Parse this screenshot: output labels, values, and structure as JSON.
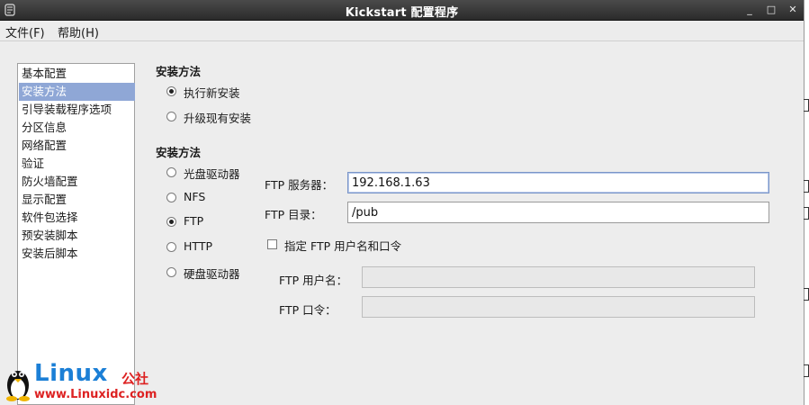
{
  "window": {
    "title": "Kickstart 配置程序",
    "controls": {
      "minimize": "_",
      "maximize": "□",
      "close": "✕"
    }
  },
  "menubar": {
    "file": "文件(F)",
    "help": "帮助(H)"
  },
  "sidebar": {
    "items": [
      {
        "label": "基本配置",
        "selected": false
      },
      {
        "label": "安装方法",
        "selected": true
      },
      {
        "label": "引导装载程序选项",
        "selected": false
      },
      {
        "label": "分区信息",
        "selected": false
      },
      {
        "label": "网络配置",
        "selected": false
      },
      {
        "label": "验证",
        "selected": false
      },
      {
        "label": "防火墙配置",
        "selected": false
      },
      {
        "label": "显示配置",
        "selected": false
      },
      {
        "label": "软件包选择",
        "selected": false
      },
      {
        "label": "预安装脚本",
        "selected": false
      },
      {
        "label": "安装后脚本",
        "selected": false
      }
    ]
  },
  "install_type": {
    "title": "安装方法",
    "options": [
      {
        "label": "执行新安装",
        "checked": true
      },
      {
        "label": "升级现有安装",
        "checked": false
      }
    ]
  },
  "install_source": {
    "title": "安装方法",
    "options": [
      {
        "label": "光盘驱动器",
        "checked": false
      },
      {
        "label": "NFS",
        "checked": false
      },
      {
        "label": "FTP",
        "checked": true
      },
      {
        "label": "HTTP",
        "checked": false
      },
      {
        "label": "硬盘驱动器",
        "checked": false
      }
    ]
  },
  "ftp": {
    "server_label": "FTP 服务器：",
    "server_value": "192.168.1.63",
    "dir_label": "FTP 目录：",
    "dir_value": "/pub",
    "specify_user_label": "指定 FTP 用户名和口令",
    "specify_user_checked": false,
    "username_label": "FTP 用户名：",
    "username_value": "",
    "password_label": "FTP 口令：",
    "password_value": ""
  },
  "watermark": {
    "brand": "Linux",
    "suffix": "公社",
    "url": "www.Linuxidc.com"
  },
  "colors": {
    "titlebar": "#2b2b2b",
    "selection": "#8fa7d6",
    "brand_blue": "#1b7fd6",
    "brand_red": "#dd2222"
  }
}
